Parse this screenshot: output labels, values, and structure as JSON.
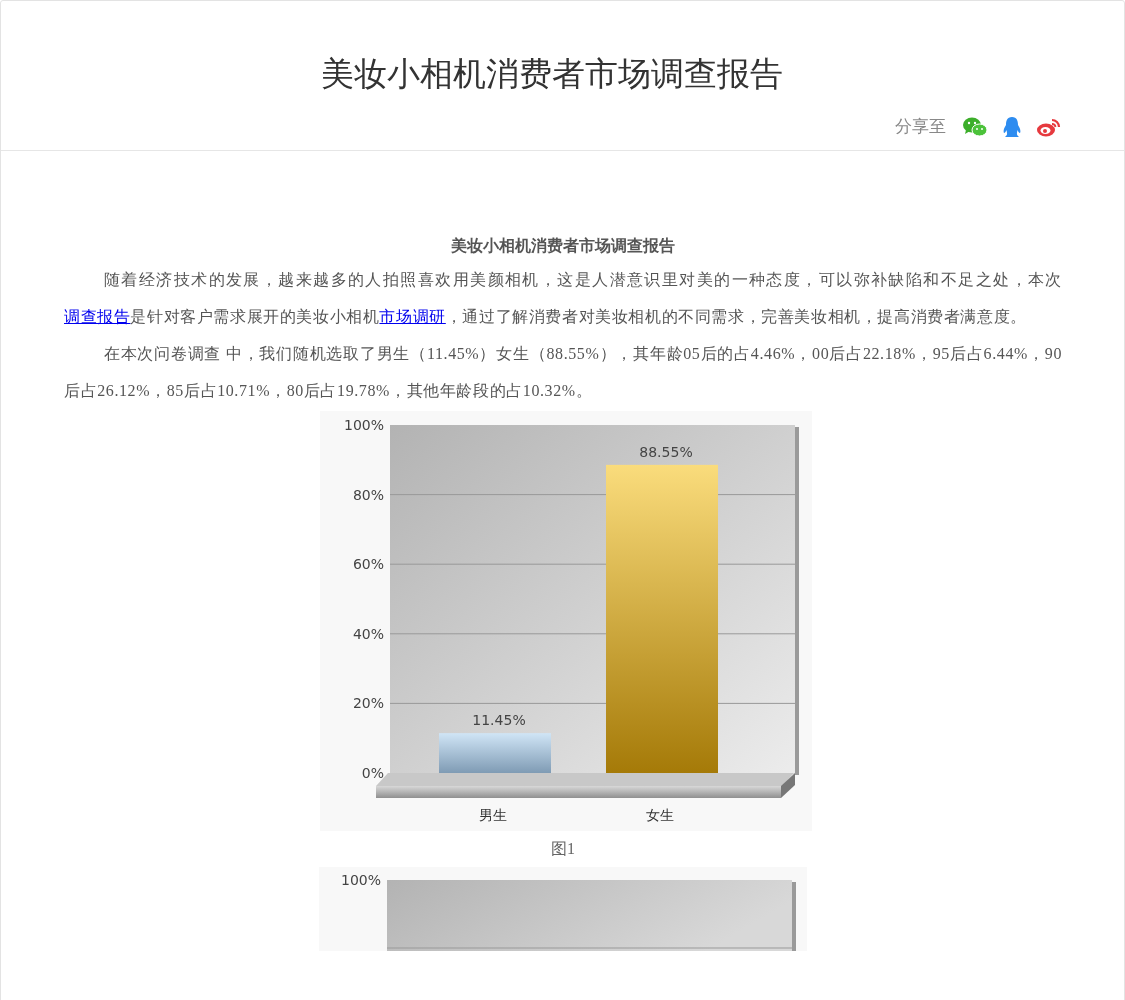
{
  "header": {
    "title": "美妆小相机消费者市场调查报告",
    "share_label": "分享至"
  },
  "article": {
    "title": "美妆小相机消费者市场调查报告",
    "paragraphs": [
      {
        "parts": [
          {
            "kind": "text",
            "text": "随着经济技术的发展，越来越多的人拍照喜欢用美颜相机，这是人潜意识里对美的一种态度，可以弥补缺陷和不足之处，本次"
          },
          {
            "kind": "link",
            "text": "调查报告"
          },
          {
            "kind": "text",
            "text": "是针对客户需求展开的美妆小相机"
          },
          {
            "kind": "link",
            "text": "市场调研"
          },
          {
            "kind": "text",
            "text": "，通过了解消费者对美妆相机的不同需求，完善美妆相机，提高消费者满意度。"
          }
        ]
      },
      {
        "parts": [
          {
            "kind": "text",
            "text": "在本次问卷调查 中，我们随机选取了男生（11.45%）女生（88.55%），其年龄05后的占4.46%，00后占22.18%，95后占6.44%，90后占26.12%，85后占10.71%，80后占19.78%，其他年龄段的占10.32%。"
          }
        ]
      }
    ],
    "figure_1": {
      "caption": "图1",
      "chart_data": {
        "type": "bar",
        "categories": [
          "男生",
          "女生"
        ],
        "series": [
          {
            "values": [
              11.45,
              88.55
            ]
          }
        ],
        "ylim": [
          0,
          100
        ],
        "yticks": [
          {
            "value": 0,
            "label": "0%"
          },
          {
            "value": 20,
            "label": "20%"
          },
          {
            "value": 40,
            "label": "40%"
          },
          {
            "value": 60,
            "label": "60%"
          },
          {
            "value": 80,
            "label": "80%"
          },
          {
            "value": 100,
            "label": "100%"
          }
        ],
        "grid": true,
        "value_labels": [
          "11.45%",
          "88.55%"
        ]
      }
    },
    "figure_2": {
      "tick_labels": [
        "100%"
      ]
    }
  }
}
